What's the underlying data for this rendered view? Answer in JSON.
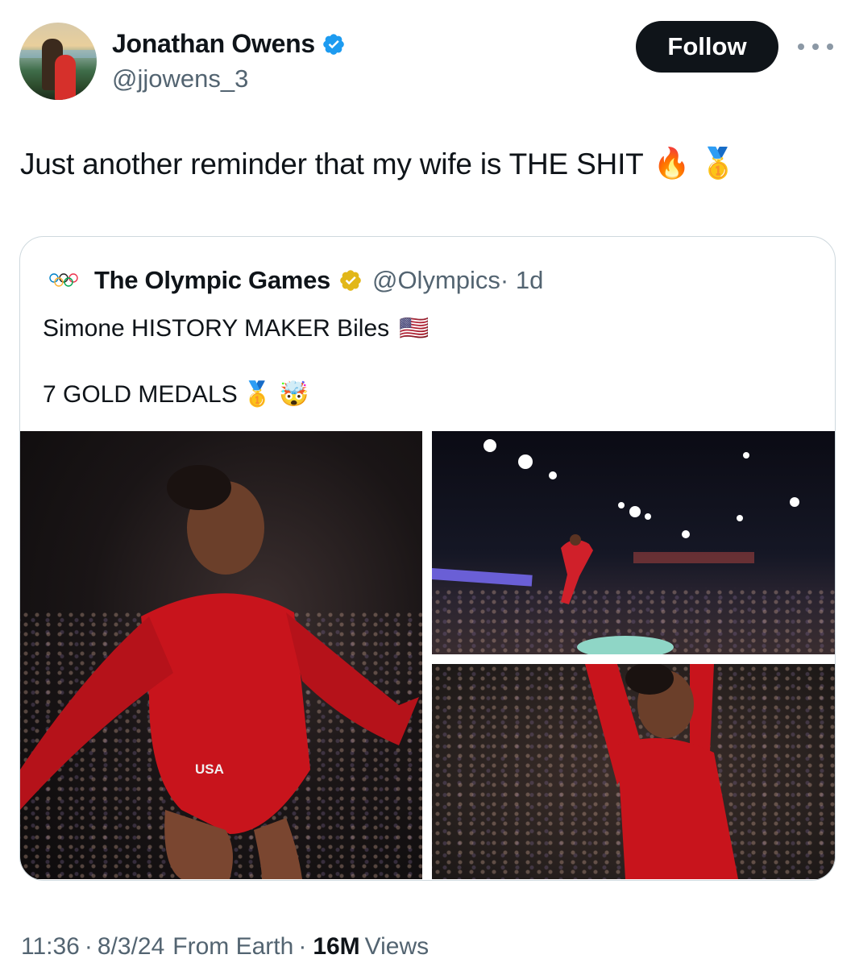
{
  "author": {
    "name": "Jonathan Owens",
    "handle": "@jjowens_3",
    "verified": true,
    "verified_color": "#1d9bf0"
  },
  "header": {
    "follow_label": "Follow",
    "more_icon": "more-horizontal-icon"
  },
  "tweet": {
    "text": "Just another reminder that my wife is THE SHIT",
    "emojis": [
      "🔥",
      "🥇"
    ]
  },
  "quote": {
    "logo": "olympic-rings-icon",
    "name": "The Olympic Games",
    "verified_color": "#e2b719",
    "handle": "@Olympics",
    "time": "· 1d",
    "line1": "Simone HISTORY MAKER Biles",
    "line1_emoji": "🇺🇸",
    "line2": "7 GOLD MEDALS",
    "line2_emojis": [
      "🥇",
      "🤯"
    ],
    "photos": [
      {
        "alt": "Gymnast smiling in red USA leotard",
        "badge": "USA"
      },
      {
        "alt": "Gymnast mid-air above vault in arena"
      },
      {
        "alt": "Gymnast with arms raised celebrating"
      }
    ]
  },
  "footer": {
    "time": "11:36",
    "date": "8/3/24",
    "source": "From Earth",
    "views_count": "16M",
    "views_label": "Views"
  }
}
